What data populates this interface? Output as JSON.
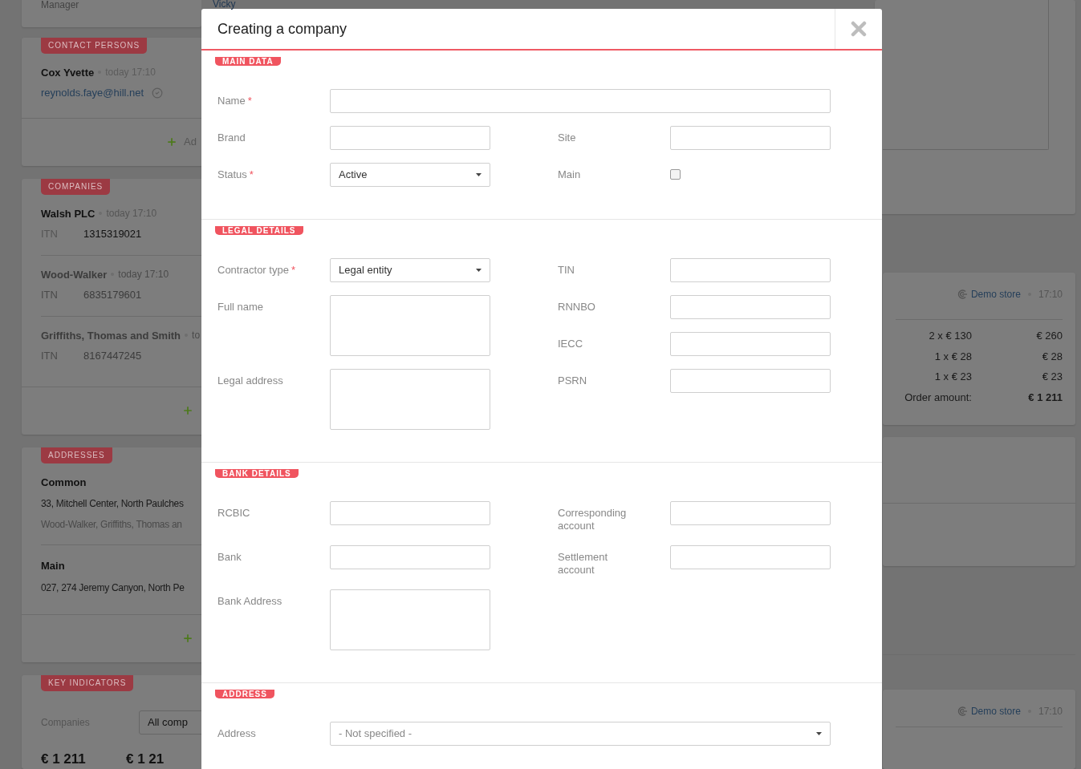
{
  "background": {
    "top_card": {
      "label": "Manager",
      "value": "Vicky"
    },
    "contact_persons": {
      "badge": "CONTACT PERSONS",
      "items": [
        {
          "name": "Cox Yvette",
          "time": "today 17:10",
          "email": "reynolds.faye@hill.net",
          "verified": true
        }
      ],
      "add": "Ad"
    },
    "companies": {
      "badge": "COMPANIES",
      "items": [
        {
          "name": "Walsh PLC",
          "time": "today 17:10",
          "field": "ITN",
          "value": "1315319021",
          "muted": false
        },
        {
          "name": "Wood-Walker",
          "time": "today 17:10",
          "field": "ITN",
          "value": "6835179601",
          "muted": true
        },
        {
          "name": "Griffiths, Thomas and Smith",
          "time": "to",
          "field": "ITN",
          "value": "8167447245",
          "muted": true
        }
      ]
    },
    "addresses": {
      "badge": "ADDRESSES",
      "items": [
        {
          "title": "Common",
          "line": "33, Mitchell Center, North Paulches",
          "note": "Wood-Walker, Griffiths, Thomas an"
        },
        {
          "title": "Main",
          "line": "027, 274 Jeremy Canyon, North Pe"
        }
      ]
    },
    "key_indicators": {
      "badge": "KEY INDICATORS",
      "label": "Companies",
      "select": "All comp",
      "values": [
        "€ 1 211",
        "€ 1 21"
      ]
    },
    "orders": [
      {
        "store": "Demo store",
        "time": "17:10",
        "lines": [
          {
            "qty": "2 x € 130",
            "sum": "€ 260"
          },
          {
            "qty": "1 x € 28",
            "sum": "€ 28"
          },
          {
            "qty": "1 x € 23",
            "sum": "€ 23"
          }
        ],
        "total_label": "Order amount:",
        "total": "€ 1 211"
      },
      {
        "store": "Demo store",
        "time": "17:10"
      }
    ]
  },
  "modal": {
    "title": "Creating a company",
    "sections": [
      {
        "badge": "MAIN DATA",
        "wide": [
          {
            "label": "Name",
            "required_mark": "*",
            "kind": "text"
          }
        ],
        "rows": [
          {
            "left": [
              {
                "label": "Brand",
                "kind": "text"
              }
            ],
            "right": [
              {
                "label": "Site",
                "kind": "text"
              }
            ]
          },
          {
            "left": [
              {
                "label": "Status",
                "required_mark": "*",
                "kind": "select",
                "value": "Active"
              }
            ],
            "right": [
              {
                "label": "Main",
                "kind": "checkbox",
                "checked": false
              }
            ]
          }
        ]
      },
      {
        "badge": "LEGAL DETAILS",
        "rows": [
          {
            "left": [
              {
                "label": "Contractor type",
                "required_mark": "*",
                "kind": "select",
                "value": "Legal entity"
              }
            ],
            "right": [
              {
                "label": "TIN",
                "kind": "text"
              }
            ]
          },
          {
            "left": [
              {
                "label": "Full name",
                "kind": "textarea"
              }
            ],
            "right": [
              {
                "label": "RNNBO",
                "kind": "text"
              },
              {
                "label": "IECC",
                "kind": "text"
              }
            ]
          },
          {
            "left": [
              {
                "label": "Legal address",
                "kind": "textarea"
              }
            ],
            "right": [
              {
                "label": "PSRN",
                "kind": "text"
              }
            ]
          }
        ]
      },
      {
        "badge": "BANK DETAILS",
        "rows": [
          {
            "left": [
              {
                "label": "RCBIC",
                "kind": "text"
              }
            ],
            "right": [
              {
                "label": "Corresponding account",
                "kind": "text"
              }
            ]
          },
          {
            "left": [
              {
                "label": "Bank",
                "kind": "text"
              }
            ],
            "right": [
              {
                "label": "Settlement account",
                "kind": "text"
              }
            ]
          },
          {
            "left": [
              {
                "label": "Bank Address",
                "kind": "textarea"
              }
            ]
          }
        ]
      },
      {
        "badge": "ADDRESS",
        "wide": [
          {
            "label": "Address",
            "kind": "select",
            "placeholder": "- Not specified -"
          }
        ]
      }
    ]
  }
}
